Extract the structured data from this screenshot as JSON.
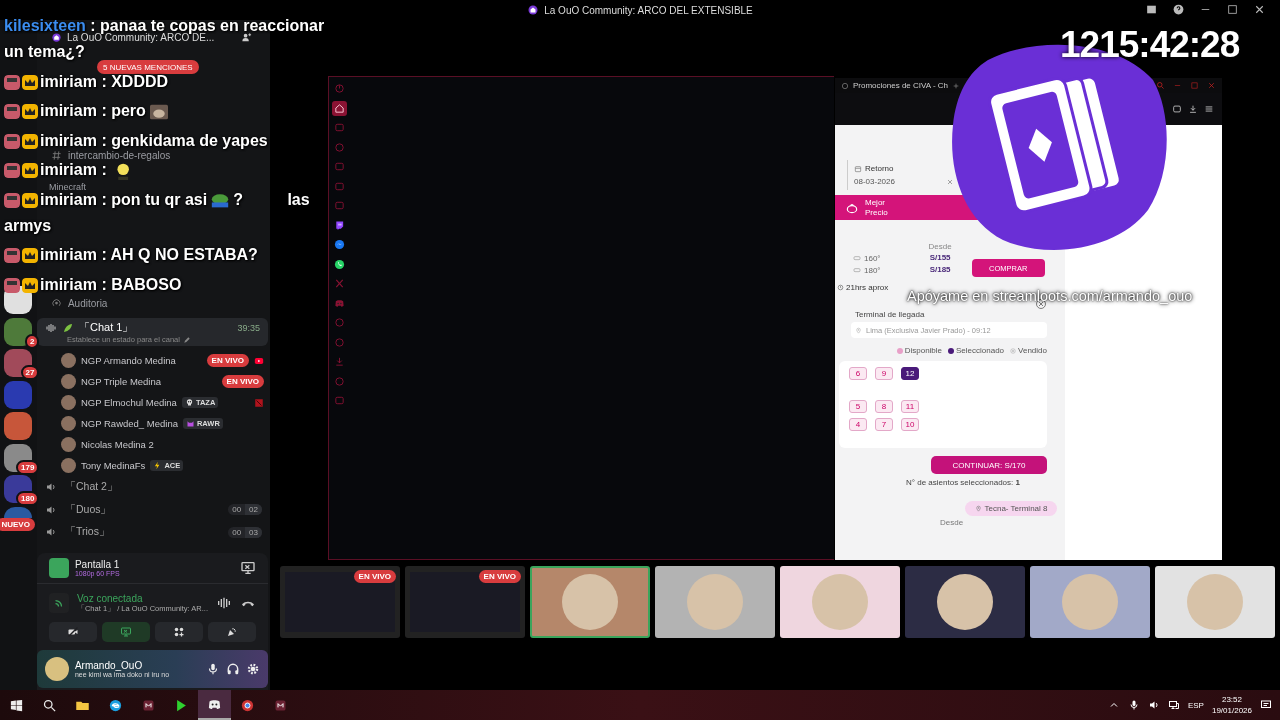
{
  "title_bar": {
    "title": "La OuO Community: ARCO DEL EXTENSIBLE"
  },
  "timer": "1215:42:28",
  "support_text": "Apóyame en streamloots.com/armando_ouo",
  "chat": [
    {
      "user": "kilesixteen",
      "color": "#3b8df0",
      "sep": ":",
      "text": "panaa te copas en reaccionar",
      "text_line2": "un tema¿?"
    },
    {
      "badges": [
        {
          "kind": "avatar"
        },
        {
          "kind": "crown"
        }
      ],
      "user": "imiriam",
      "color": "#ffffff",
      "sep": ":",
      "text": "XDDDD"
    },
    {
      "badges": [
        {
          "kind": "avatar"
        },
        {
          "kind": "crown"
        }
      ],
      "user": "imiriam",
      "color": "#ffffff",
      "sep": ":",
      "text": "pero",
      "emote": {
        "kind": "cat"
      }
    },
    {
      "badges": [
        {
          "kind": "avatar"
        },
        {
          "kind": "crown"
        }
      ],
      "user": "imiriam",
      "color": "#ffffff",
      "sep": ":",
      "text": "genkidama de yapes"
    },
    {
      "badges": [
        {
          "kind": "avatar"
        },
        {
          "kind": "crown"
        }
      ],
      "user": "imiriam",
      "color": "#ffffff",
      "sep": ":",
      "emote": {
        "kind": "face"
      }
    },
    {
      "badges": [
        {
          "kind": "avatar"
        },
        {
          "kind": "crown"
        }
      ],
      "user": "imiriam",
      "color": "#ffffff",
      "sep": ":",
      "text": "pon tu qr asi",
      "emote": {
        "kind": "frog"
      },
      "after": "?",
      "tail": "las",
      "text_line2": "armys"
    },
    {
      "badges": [
        {
          "kind": "avatar"
        },
        {
          "kind": "crown"
        }
      ],
      "user": "imiriam",
      "color": "#ffffff",
      "sep": ":",
      "text": "AH Q NO ESTABA?"
    },
    {
      "badges": [
        {
          "kind": "avatar"
        },
        {
          "kind": "crown"
        }
      ],
      "user": "imiriam",
      "color": "#ffffff",
      "sep": ":",
      "text": "BABOSO"
    }
  ],
  "servers": [
    {
      "kind": "server"
    },
    {
      "kind": "server",
      "badge": "2"
    },
    {
      "kind": "server",
      "badge": "27"
    },
    {
      "kind": "server"
    },
    {
      "kind": "server"
    },
    {
      "kind": "server",
      "badge": "179"
    },
    {
      "kind": "server",
      "badge": "180"
    },
    {
      "kind": "new",
      "badge": "NUEVO"
    }
  ],
  "server": {
    "name": "La OuO Community: ARCO DE...",
    "mentions": "5 NUEVAS MENCIONES"
  },
  "channels": [
    {
      "kind": "text",
      "name": "intercambio-de-regalos"
    },
    {
      "kind": "category",
      "name": "Minecraft"
    },
    {
      "kind": "stage",
      "name": "Auditoria"
    }
  ],
  "voice_channel": {
    "name": "「Chat 1」",
    "time": "39:35",
    "status": "Establece un estado para el canal",
    "members": [
      {
        "name": "NGP Armando Medina",
        "badge": "EN VIVO",
        "activity": {
          "kind": "video"
        }
      },
      {
        "name": "NGP Triple Medina",
        "badge": "EN VIVO"
      },
      {
        "name": "NGP Elmochul Medina",
        "tag": "TAZA",
        "activity": {
          "kind": "game"
        }
      },
      {
        "name": "NGP Rawded_ Medina",
        "tag": "RAWR"
      },
      {
        "name": "Nicolas Medina 2"
      },
      {
        "name": "Tony MedinaFs",
        "tag": "ACE"
      }
    ]
  },
  "voice_channels": [
    {
      "name": "「Chat 2」"
    },
    {
      "name": "「Duos」",
      "count": "00",
      "limit": "02"
    },
    {
      "name": "「Trios」",
      "count": "00",
      "limit": "03"
    }
  ],
  "screen_share": {
    "title": "Pantalla 1",
    "quality": "1080p 60 FPS"
  },
  "voice_status": {
    "status": "Voz conectada",
    "channel": "「Chat 1」 / La OuO Community: AR..."
  },
  "user": {
    "name": "Armando_OuO",
    "status": "nee kimi wa ima doko ni iru no"
  },
  "browser_rail": [
    {
      "kind": "power",
      "selected": false
    },
    {
      "kind": "home",
      "selected": true
    },
    {
      "kind": "box",
      "selected": false
    },
    {
      "kind": "circle",
      "selected": false
    },
    {
      "kind": "box",
      "selected": false
    },
    {
      "kind": "box",
      "selected": false
    },
    {
      "kind": "box",
      "selected": false
    },
    {
      "kind": "twitch",
      "selected": false
    },
    {
      "kind": "messenger",
      "selected": false
    },
    {
      "kind": "whatsapp",
      "selected": false
    },
    {
      "kind": "x",
      "selected": false
    },
    {
      "kind": "discord",
      "selected": false
    },
    {
      "kind": "circle",
      "selected": false
    },
    {
      "kind": "circle",
      "selected": false
    },
    {
      "kind": "download",
      "selected": false
    },
    {
      "kind": "circle",
      "selected": false
    },
    {
      "kind": "box",
      "selected": false
    }
  ],
  "civa": {
    "tab": "Promociones de CIVA - Ch",
    "return_label": "Retorno",
    "return_date": "08-03-2026",
    "best_price": "Mejor Precio",
    "from": "Desde",
    "fares": [
      {
        "seat": "160°",
        "price": "S/155"
      },
      {
        "seat": "180°",
        "price": "S/185"
      }
    ],
    "buy": "COMPRAR",
    "duration": "21hrs aprox",
    "arrival_label": "Terminal de llegada",
    "arrival": "Lima (Exclusiva Javier Prado) - 09:12",
    "legend": [
      "Disponible",
      "Seleccionado",
      "Vendido"
    ],
    "seat_rows": [
      [
        {
          "number": "6",
          "selected": false
        },
        {
          "number": "9",
          "selected": false
        },
        {
          "number": "12",
          "selected": true
        }
      ],
      [
        {
          "number": "5",
          "selected": false
        },
        {
          "number": "8",
          "selected": false
        },
        {
          "number": "11",
          "selected": false
        }
      ],
      [
        {
          "number": "4",
          "selected": false
        },
        {
          "number": "7",
          "selected": false
        },
        {
          "number": "10",
          "selected": false
        }
      ]
    ],
    "continue": "CONTINUAR: S/170",
    "seats_count": "N° de asientos seleccionados: **1**",
    "terminal": "Tecna- Terminal 8",
    "from_2": "Desde"
  },
  "streams": [
    {
      "kind": "screen",
      "badge": "EN VIVO",
      "selected": false
    },
    {
      "kind": "screen",
      "badge": "EN VIVO",
      "selected": false
    },
    {
      "kind": "avatar",
      "selected": true,
      "color": "#b5876a"
    },
    {
      "kind": "avatar",
      "selected": false,
      "color": "#b3b3b3"
    },
    {
      "kind": "avatar",
      "selected": false,
      "color": "#efd6df"
    },
    {
      "kind": "avatar",
      "selected": false,
      "color": "#2c2c44"
    },
    {
      "kind": "avatar",
      "selected": false,
      "color": "#a2a9c8"
    },
    {
      "kind": "avatar",
      "selected": false,
      "color": "#e2e2e2"
    }
  ],
  "taskbar": [
    {
      "kind": "start",
      "selected": false
    },
    {
      "kind": "search",
      "selected": false
    },
    {
      "kind": "folder",
      "selected": false
    },
    {
      "kind": "edge",
      "selected": false
    },
    {
      "kind": "app",
      "selected": false
    },
    {
      "kind": "green",
      "selected": false
    },
    {
      "kind": "discord",
      "selected": true
    },
    {
      "kind": "chrome",
      "selected": false
    },
    {
      "kind": "app",
      "selected": false
    }
  ],
  "tray": {
    "language": "ESP",
    "time": "23:52",
    "date": "19/01/2026"
  }
}
